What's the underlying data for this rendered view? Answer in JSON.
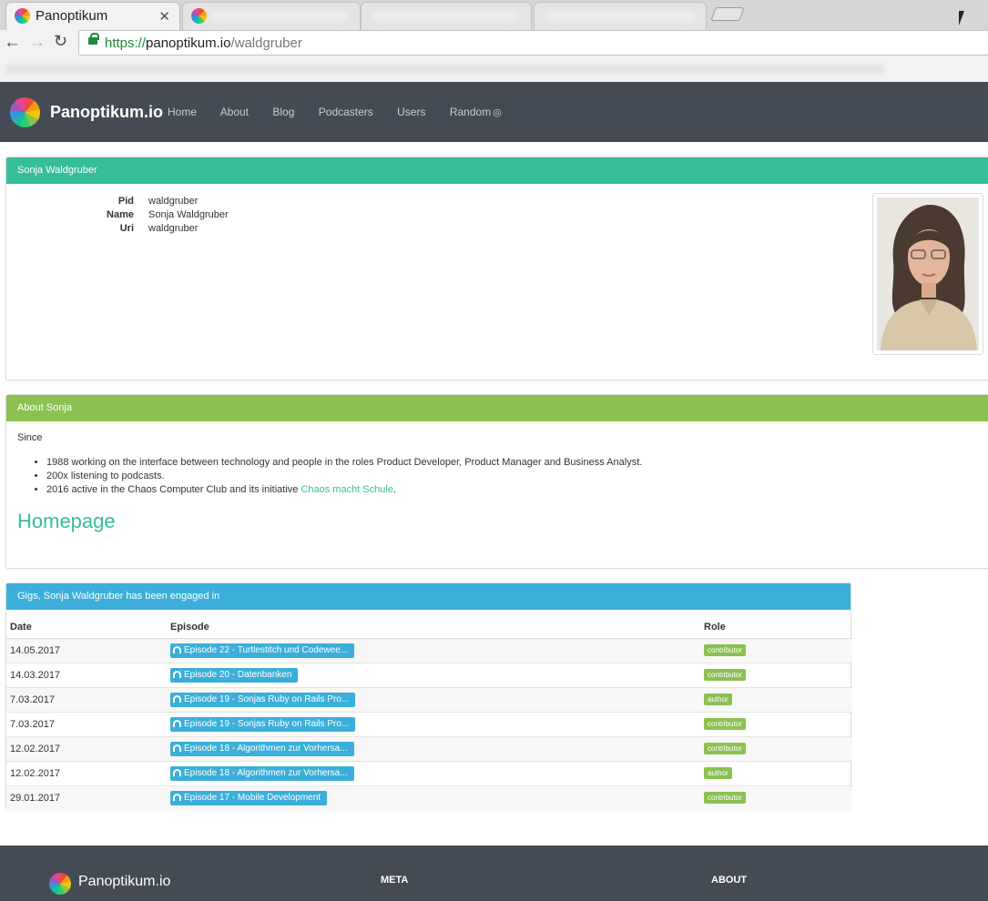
{
  "browser": {
    "active_tab_title": "Panoptikum",
    "tab_close": "✕",
    "url_scheme": "https://",
    "url_host": "panoptikum.io",
    "url_path": "/waldgruber"
  },
  "nav": {
    "brand": "Panoptikum.io",
    "links": [
      "Home",
      "About",
      "Blog",
      "Podcasters",
      "Users",
      "Random"
    ]
  },
  "profile": {
    "header": "Sonja Waldgruber",
    "fields": [
      {
        "label": "Pid",
        "value": "waldgruber"
      },
      {
        "label": "Name",
        "value": "Sonja Waldgruber"
      },
      {
        "label": "Uri",
        "value": "waldgruber"
      }
    ]
  },
  "about": {
    "header": "About Sonja",
    "since": "Since",
    "items": [
      "1988 working on the interface between technology and people in the roles Product Developer, Product Manager and Business Analyst.",
      "200x listening to podcasts."
    ],
    "item3_prefix": "2016 active in the Chaos Computer Club and its initiative ",
    "item3_link": "Chaos macht Schule",
    "item3_suffix": ".",
    "homepage": "Homepage"
  },
  "gigs": {
    "header": "Gigs, Sonja Waldgruber has been engaged in",
    "columns": [
      "Date",
      "Episode",
      "Role"
    ],
    "rows": [
      {
        "date": "14.05.2017",
        "episode": "Episode 22 - Turtlestitch und Codewee...",
        "role": "contributor"
      },
      {
        "date": "14.03.2017",
        "episode": "Episode 20 - Datenbanken",
        "role": "contributor"
      },
      {
        "date": "7.03.2017",
        "episode": "Episode 19 - Sonjas Ruby on Rails Pro...",
        "role": "author"
      },
      {
        "date": "7.03.2017",
        "episode": "Episode 19 - Sonjas Ruby on Rails Pro...",
        "role": "contributor"
      },
      {
        "date": "12.02.2017",
        "episode": "Episode 18 - Algorithmen zur Vorhersa...",
        "role": "contributor"
      },
      {
        "date": "12.02.2017",
        "episode": "Episode 18 - Algorithmen zur Vorhersa...",
        "role": "author"
      },
      {
        "date": "29.01.2017",
        "episode": "Episode 17 - Mobile Development",
        "role": "contributor"
      }
    ]
  },
  "footer": {
    "brand": "Panoptikum.io",
    "meta": "META",
    "about": "ABOUT"
  },
  "colors": {
    "navbar": "#454b54",
    "teal": "#37bd9a",
    "green": "#8cc152",
    "blue": "#3bafda"
  }
}
